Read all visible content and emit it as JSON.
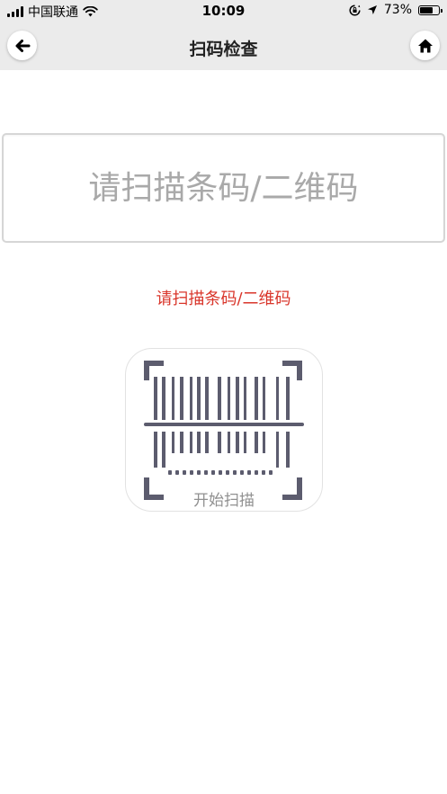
{
  "status_bar": {
    "carrier": "中国联通",
    "time": "10:09",
    "battery": "73%",
    "battery_level": 0.73
  },
  "nav": {
    "title": "扫码检查",
    "back_icon": "arrow-left-icon",
    "home_icon": "home-icon"
  },
  "scan_input": {
    "placeholder": "请扫描条码/二维码",
    "value": ""
  },
  "hint": {
    "text": "请扫描条码/二维码",
    "color": "#d9362b"
  },
  "scan_button": {
    "label": "开始扫描",
    "icon": "barcode-scan-icon",
    "icon_color": "#5c5c6e"
  }
}
